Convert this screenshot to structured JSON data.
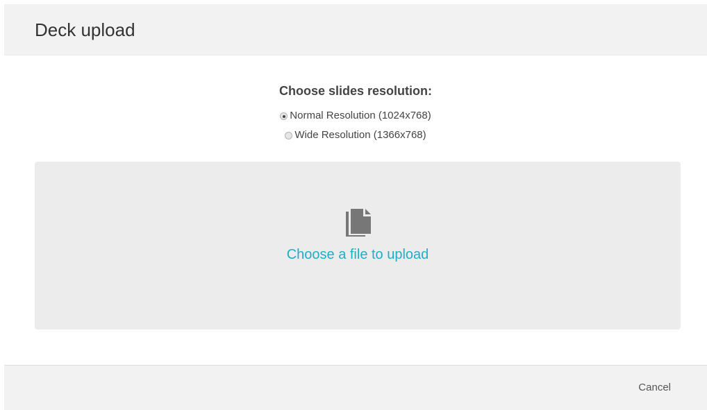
{
  "dialog": {
    "title": "Deck upload"
  },
  "resolution": {
    "heading": "Choose slides resolution:",
    "options": [
      {
        "label": "Normal Resolution (1024x768)",
        "selected": true
      },
      {
        "label": "Wide Resolution (1366x768)",
        "selected": false
      }
    ]
  },
  "dropzone": {
    "icon": "file-icon",
    "link_text": "Choose a file to upload"
  },
  "footer": {
    "cancel_label": "Cancel"
  },
  "colors": {
    "link": "#1ab0cc",
    "header_bg": "#f2f2f2",
    "dropzone_bg": "#ececec"
  }
}
